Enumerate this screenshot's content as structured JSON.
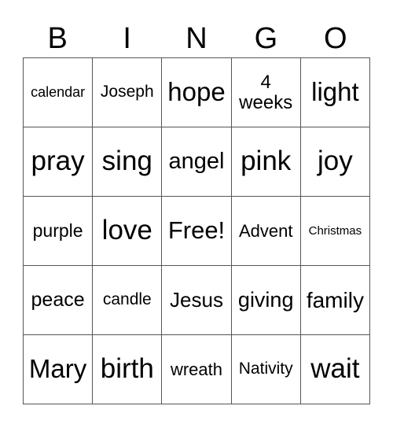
{
  "header": {
    "letters": [
      "B",
      "I",
      "N",
      "G",
      "O"
    ]
  },
  "board": {
    "rows": [
      [
        {
          "text": "calendar",
          "size": 18
        },
        {
          "text": "Joseph",
          "size": 21
        },
        {
          "text": "hope",
          "size": 33
        },
        {
          "text": "4 weeks",
          "size": 24,
          "wrap": true
        },
        {
          "text": "light",
          "size": 33
        }
      ],
      [
        {
          "text": "pray",
          "size": 35
        },
        {
          "text": "sing",
          "size": 35
        },
        {
          "text": "angel",
          "size": 29
        },
        {
          "text": "pink",
          "size": 35
        },
        {
          "text": "joy",
          "size": 35
        }
      ],
      [
        {
          "text": "purple",
          "size": 23
        },
        {
          "text": "love",
          "size": 35
        },
        {
          "text": "Free!",
          "size": 31
        },
        {
          "text": "Advent",
          "size": 22
        },
        {
          "text": "Christmas",
          "size": 15
        }
      ],
      [
        {
          "text": "peace",
          "size": 25
        },
        {
          "text": "candle",
          "size": 21
        },
        {
          "text": "Jesus",
          "size": 26
        },
        {
          "text": "giving",
          "size": 27
        },
        {
          "text": "family",
          "size": 28
        }
      ],
      [
        {
          "text": "Mary",
          "size": 33
        },
        {
          "text": "birth",
          "size": 35
        },
        {
          "text": "wreath",
          "size": 22
        },
        {
          "text": "Nativity",
          "size": 21
        },
        {
          "text": "wait",
          "size": 35
        }
      ]
    ]
  }
}
